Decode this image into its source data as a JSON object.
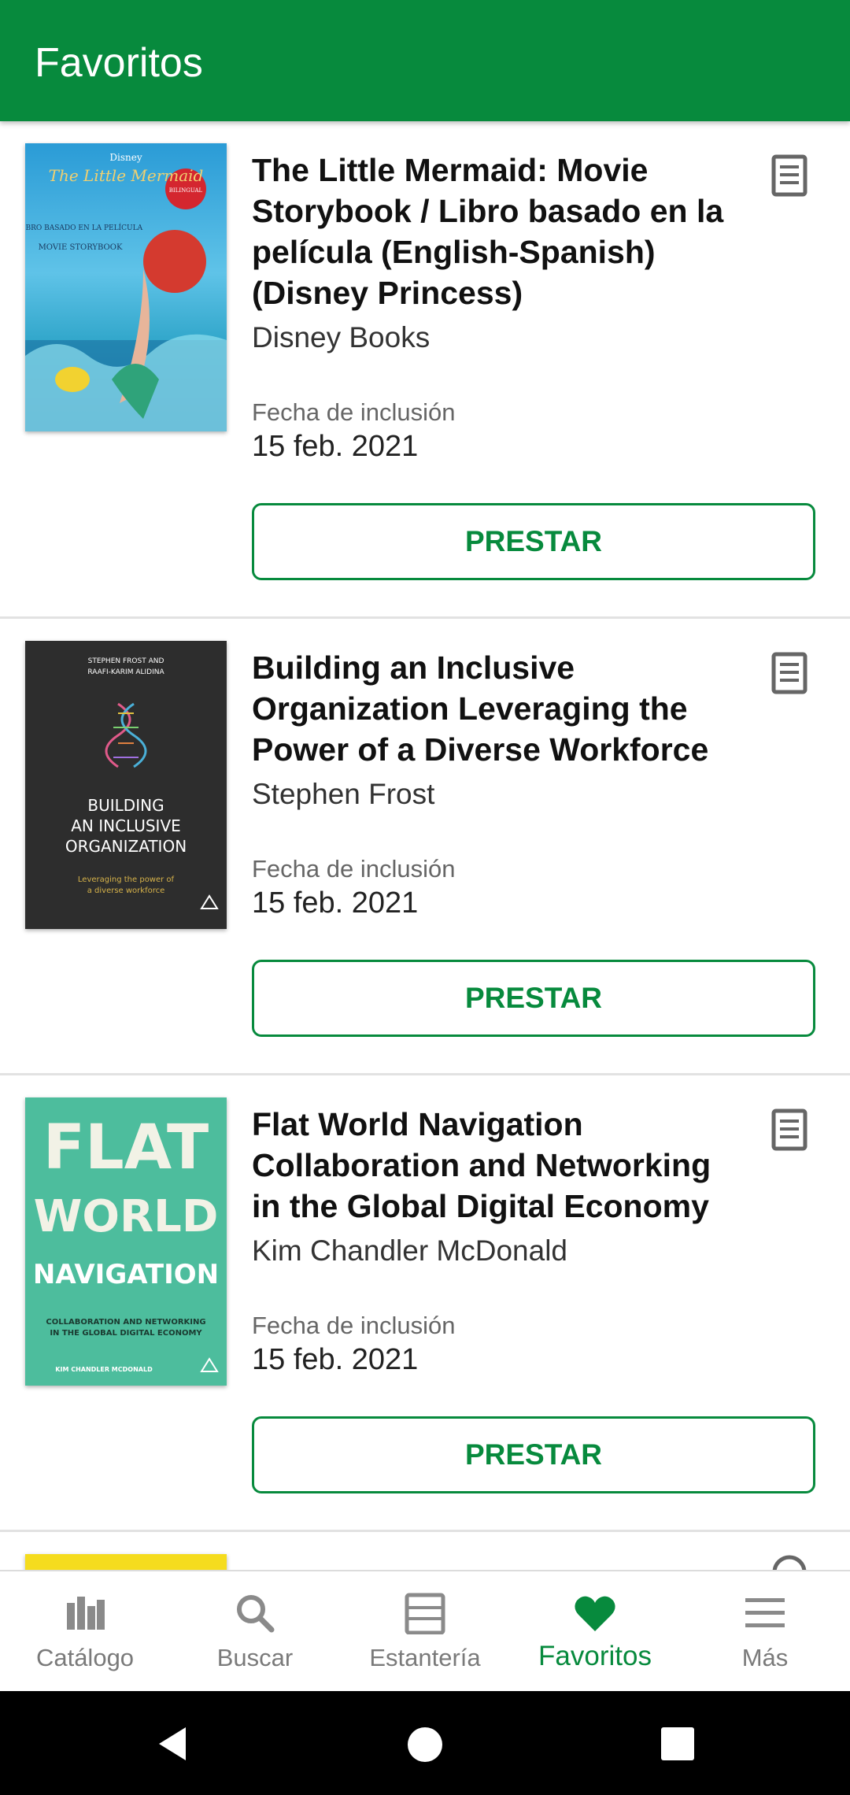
{
  "header": {
    "title": "Favoritos"
  },
  "items": [
    {
      "title": "The Little Mermaid: Movie Storybook / Libro basado en la película (English-Spanish) (Disney Princess)",
      "author": "Disney Books",
      "date_label": "Fecha de inclusión",
      "date": "15 feb. 2021",
      "button": "PRESTAR",
      "cover_text": [
        "Disney",
        "The Little Mermaid",
        "LIBRO BASADO EN LA PELÍCULA",
        "MOVIE STORYBOOK",
        "BILINGUAL"
      ]
    },
    {
      "title": "Building an Inclusive Organization Leveraging the Power of a Diverse Workforce",
      "author": "Stephen Frost",
      "date_label": "Fecha de inclusión",
      "date": "15 feb. 2021",
      "button": "PRESTAR",
      "cover_text": [
        "STEPHEN FROST AND",
        "RAAFI-KARIM ALIDINA",
        "BUILDING",
        "AN INCLUSIVE",
        "ORGANIZATION",
        "Leveraging the power of",
        "a diverse workforce"
      ]
    },
    {
      "title": "Flat World Navigation Collaboration and Networking in the Global Digital Economy",
      "author": "Kim Chandler McDonald",
      "date_label": "Fecha de inclusión",
      "date": "15 feb. 2021",
      "button": "PRESTAR",
      "cover_text": [
        "FLAT",
        "WORLD",
        "NAVIGATION",
        "COLLABORATION AND NETWORKING",
        "IN THE GLOBAL DIGITAL ECONOMY",
        "KIM CHANDLER MCDONALD"
      ]
    }
  ],
  "bottom_nav": [
    {
      "label": "Catálogo",
      "icon": "catalog-icon",
      "active": false
    },
    {
      "label": "Buscar",
      "icon": "search-icon",
      "active": false
    },
    {
      "label": "Estantería",
      "icon": "shelf-icon",
      "active": false
    },
    {
      "label": "Favoritos",
      "icon": "heart-icon",
      "active": true
    },
    {
      "label": "Más",
      "icon": "menu-icon",
      "active": false
    }
  ],
  "colors": {
    "primary": "#078a3d",
    "inactive": "#7a7a7a"
  }
}
